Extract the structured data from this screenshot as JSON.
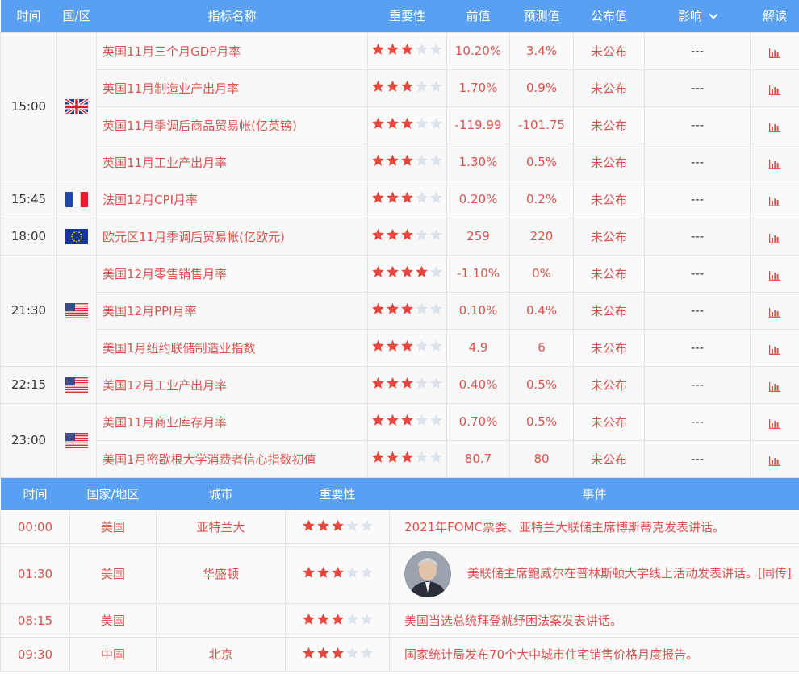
{
  "top": {
    "headers": [
      "时间",
      "国/区",
      "指标名称",
      "重要性",
      "前值",
      "预测值",
      "公布值",
      "影响",
      "解读"
    ],
    "groups": [
      {
        "time": "15:00",
        "country": "uk",
        "rows": [
          {
            "name": "英国11月三个月GDP月率",
            "stars": 3,
            "prev": "10.20%",
            "forecast": "3.4%",
            "actual": "未公布",
            "impact": "---"
          },
          {
            "name": "英国11月制造业产出月率",
            "stars": 3,
            "prev": "1.70%",
            "forecast": "0.9%",
            "actual": "未公布",
            "impact": "---"
          },
          {
            "name": "英国11月季调后商品贸易帐(亿英镑)",
            "stars": 3,
            "prev": "-119.99",
            "forecast": "-101.75",
            "actual": "未公布",
            "impact": "---"
          },
          {
            "name": "英国11月工业产出月率",
            "stars": 3,
            "prev": "1.30%",
            "forecast": "0.5%",
            "actual": "未公布",
            "impact": "---"
          }
        ]
      },
      {
        "time": "15:45",
        "country": "fr",
        "rows": [
          {
            "name": "法国12月CPI月率",
            "stars": 3,
            "prev": "0.20%",
            "forecast": "0.2%",
            "actual": "未公布",
            "impact": "---"
          }
        ]
      },
      {
        "time": "18:00",
        "country": "eu",
        "rows": [
          {
            "name": "欧元区11月季调后贸易帐(亿欧元)",
            "stars": 3,
            "prev": "259",
            "forecast": "220",
            "actual": "未公布",
            "impact": "---"
          }
        ]
      },
      {
        "time": "21:30",
        "country": "us",
        "rows": [
          {
            "name": "美国12月零售销售月率",
            "stars": 4,
            "prev": "-1.10%",
            "forecast": "0%",
            "actual": "未公布",
            "impact": "---"
          },
          {
            "name": "美国12月PPI月率",
            "stars": 3,
            "prev": "0.10%",
            "forecast": "0.4%",
            "actual": "未公布",
            "impact": "---"
          },
          {
            "name": "美国1月纽约联储制造业指数",
            "stars": 3,
            "prev": "4.9",
            "forecast": "6",
            "actual": "未公布",
            "impact": "---"
          }
        ]
      },
      {
        "time": "22:15",
        "country": "us",
        "rows": [
          {
            "name": "美国12月工业产出月率",
            "stars": 3,
            "prev": "0.40%",
            "forecast": "0.5%",
            "actual": "未公布",
            "impact": "---"
          }
        ]
      },
      {
        "time": "23:00",
        "country": "us",
        "rows": [
          {
            "name": "美国11月商业库存月率",
            "stars": 3,
            "prev": "0.70%",
            "forecast": "0.5%",
            "actual": "未公布",
            "impact": "---"
          },
          {
            "name": "美国1月密歇根大学消费者信心指数初值",
            "stars": 3,
            "prev": "80.7",
            "forecast": "80",
            "actual": "未公布",
            "impact": "---"
          }
        ]
      }
    ]
  },
  "events": {
    "headers": [
      "时间",
      "国家/地区",
      "城市",
      "重要性",
      "事件"
    ],
    "rows": [
      {
        "time": "00:00",
        "country": "美国",
        "city": "亚特兰大",
        "stars": 3,
        "event": "2021年FOMC票委、亚特兰大联储主席博斯蒂克发表讲话。",
        "avatar": false
      },
      {
        "time": "01:30",
        "country": "美国",
        "city": "华盛顿",
        "stars": 3,
        "event": "美联储主席鲍威尔在普林斯顿大学线上活动发表讲话。[同传]",
        "avatar": true
      },
      {
        "time": "08:15",
        "country": "美国",
        "city": "",
        "stars": 3,
        "event": "美国当选总统拜登就纾困法案发表讲话。",
        "avatar": false
      },
      {
        "time": "09:30",
        "country": "中国",
        "city": "北京",
        "stars": 3,
        "event": "国家统计局发布70个大中城市住宅销售价格月度报告。",
        "avatar": false
      }
    ]
  },
  "colors": {
    "header_bg": "#5aa0f2",
    "accent_red": "#d9534f",
    "star_on": "#e8473f",
    "star_off": "#dde3ec"
  }
}
